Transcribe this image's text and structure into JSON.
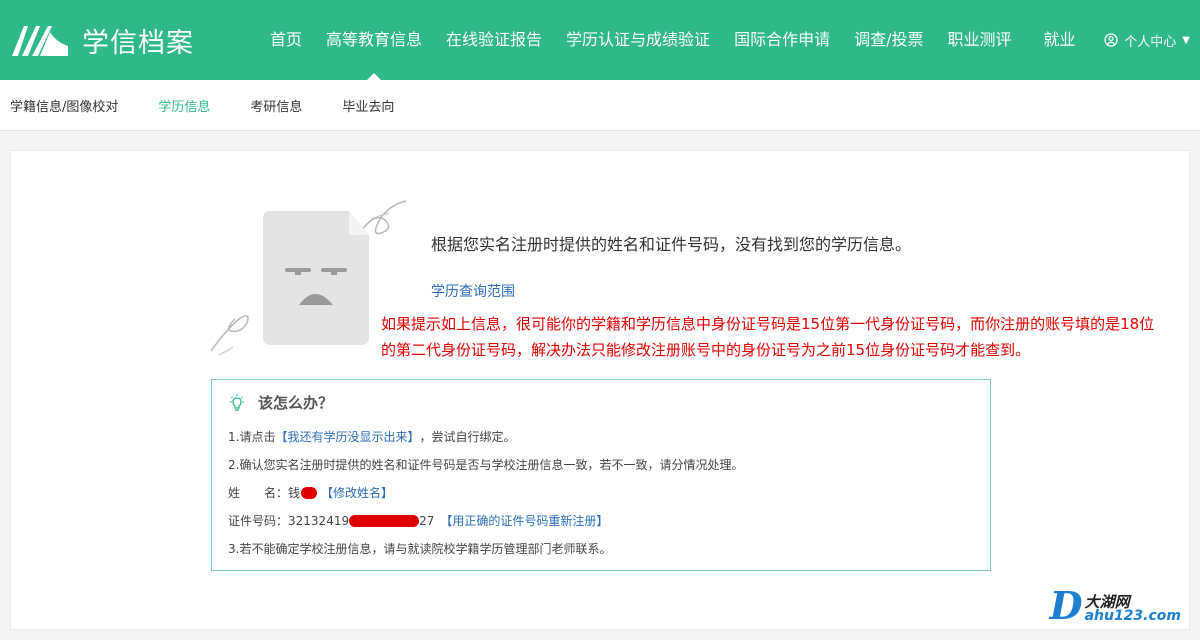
{
  "header": {
    "logo_text": "学信档案",
    "nav": [
      {
        "label": "首页"
      },
      {
        "label": "高等教育信息"
      },
      {
        "label": "在线验证报告"
      },
      {
        "label": "学历认证与成绩验证"
      },
      {
        "label": "国际合作申请"
      },
      {
        "label": "调查/投票"
      },
      {
        "label": "职业测评"
      },
      {
        "label": "就业"
      }
    ],
    "active_nav": "高等教育信息",
    "user_menu_label": "个人中心"
  },
  "subnav": {
    "items": [
      {
        "label": "学籍信息/图像校对"
      },
      {
        "label": "学历信息"
      },
      {
        "label": "考研信息"
      },
      {
        "label": "毕业去向"
      }
    ],
    "active": "学历信息"
  },
  "main": {
    "message": "根据您实名注册时提供的姓名和证件号码，没有找到您的学历信息。",
    "scope_link": "学历查询范围",
    "red_note": "如果提示如上信息，很可能你的学籍和学历信息中身份证号码是15位第一代身份证号码，而你注册的账号填的是18位的第二代身份证号码，解决办法只能修改注册账号中的身份证号为之前15位身份证号码才能查到。"
  },
  "help": {
    "title": "该怎么办？",
    "step1_prefix": "1.请点击",
    "step1_link": "【我还有学历没显示出来】",
    "step1_suffix": "，尝试自行绑定。",
    "step2": "2.确认您实名注册时提供的姓名和证件号码是否与学校注册信息一致，若不一致，请分情况处理。",
    "name_label": "姓　　名：",
    "name_value": "钱",
    "name_link": "【修改姓名】",
    "id_label": "证件号码：",
    "id_prefix": "32132419",
    "id_suffix": "27",
    "id_link": "【用正确的证件号码重新注册】",
    "step3": "3.若不能确定学校注册信息，请与就读院校学籍学历管理部门老师联系。"
  },
  "watermark": {
    "letter": "D",
    "cn": "大湖网",
    "url": "ahu123.com"
  },
  "colors": {
    "brand_green": "#2fb888",
    "link_blue": "#2b6db8",
    "alert_red": "#e00000"
  }
}
